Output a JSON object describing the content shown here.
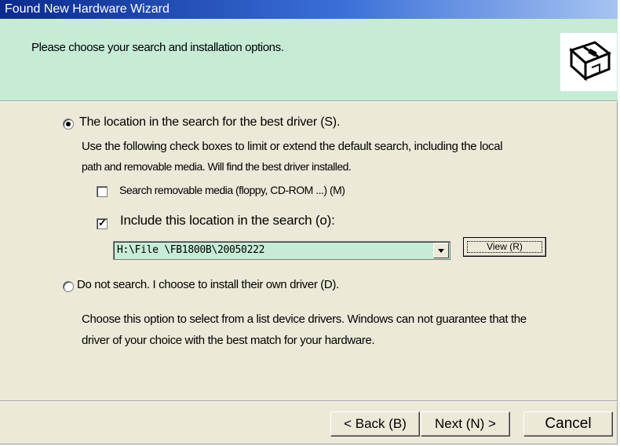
{
  "window": {
    "title": "Found New Hardware Wizard"
  },
  "header": {
    "instruction": "Please choose your search and installation options."
  },
  "option_search": {
    "label": "The location in the search for the best driver (S).",
    "description_line1": "Use the following check boxes to limit or extend the default search, including the local",
    "description_line2": "path and removable media. Will find the best driver installed.",
    "selected": true
  },
  "check_removable": {
    "label": "Search removable media (floppy, CD-ROM ...) (M)",
    "checked": false
  },
  "check_location": {
    "label": "Include this location in the search (o):",
    "checked": true
  },
  "location_combo": {
    "value": "H:\\File \\FB1800B\\20050222"
  },
  "view_button": {
    "label": "View (R)"
  },
  "option_manual": {
    "label": "Do not search. I choose to install their own driver (D).",
    "description_line1": "Choose this option to select from a list device drivers. Windows can not guarantee that the",
    "description_line2": "driver of your choice with the best match for your hardware.",
    "selected": false
  },
  "footer": {
    "back_label": "< Back (B)",
    "next_label": "Next (N) >",
    "cancel_label": "Cancel"
  },
  "colors": {
    "title_bar": "#0a2a8e",
    "header_bg": "#c6ecd6",
    "dialog_bg": "#ece9d8"
  },
  "icons": {
    "header": "hardware-install-icon"
  }
}
